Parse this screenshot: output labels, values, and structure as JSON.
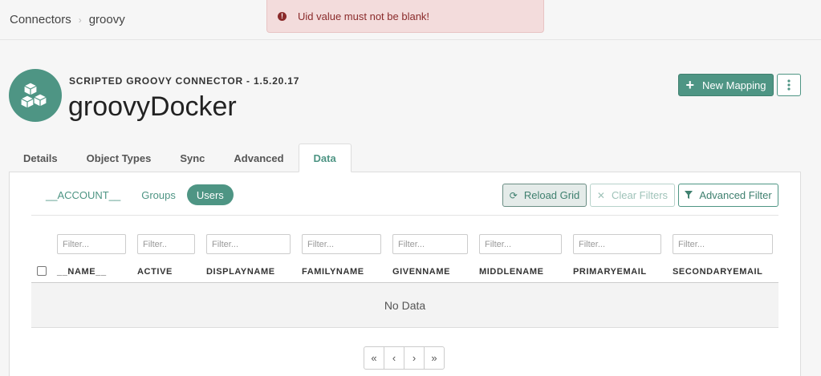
{
  "breadcrumb": {
    "root": "Connectors",
    "separator": "›",
    "current": "groovy"
  },
  "alert": {
    "message": "Uid value must not be blank!",
    "icon": "exclamation-icon"
  },
  "header": {
    "subtitle": "SCRIPTED GROOVY CONNECTOR - 1.5.20.17",
    "title": "groovyDocker",
    "new_mapping": "New Mapping"
  },
  "tabs": [
    "Details",
    "Object Types",
    "Sync",
    "Advanced",
    "Data"
  ],
  "active_tab": "Data",
  "object_types": [
    "__ACCOUNT__",
    "Groups",
    "Users"
  ],
  "active_object_type": "Users",
  "toolbar": {
    "reload": "Reload Grid",
    "clear": "Clear Filters",
    "advanced": "Advanced Filter"
  },
  "grid": {
    "columns": [
      {
        "name": "__NAME__",
        "filter": "Filter..."
      },
      {
        "name": "ACTIVE",
        "filter": "Filter.."
      },
      {
        "name": "DISPLAYNAME",
        "filter": "Filter..."
      },
      {
        "name": "FAMILYNAME",
        "filter": "Filter..."
      },
      {
        "name": "GIVENNAME",
        "filter": "Filter..."
      },
      {
        "name": "MIDDLENAME",
        "filter": "Filter..."
      },
      {
        "name": "PRIMARYEMAIL",
        "filter": "Filter..."
      },
      {
        "name": "SECONDARYEMAIL",
        "filter": "Filter..."
      }
    ],
    "empty_text": "No Data"
  },
  "pager": [
    "«",
    "‹",
    "›",
    "»"
  ],
  "colors": {
    "accent": "#4e9584",
    "alert_bg": "#f3dcdc",
    "alert_text": "#8a2b2b"
  }
}
